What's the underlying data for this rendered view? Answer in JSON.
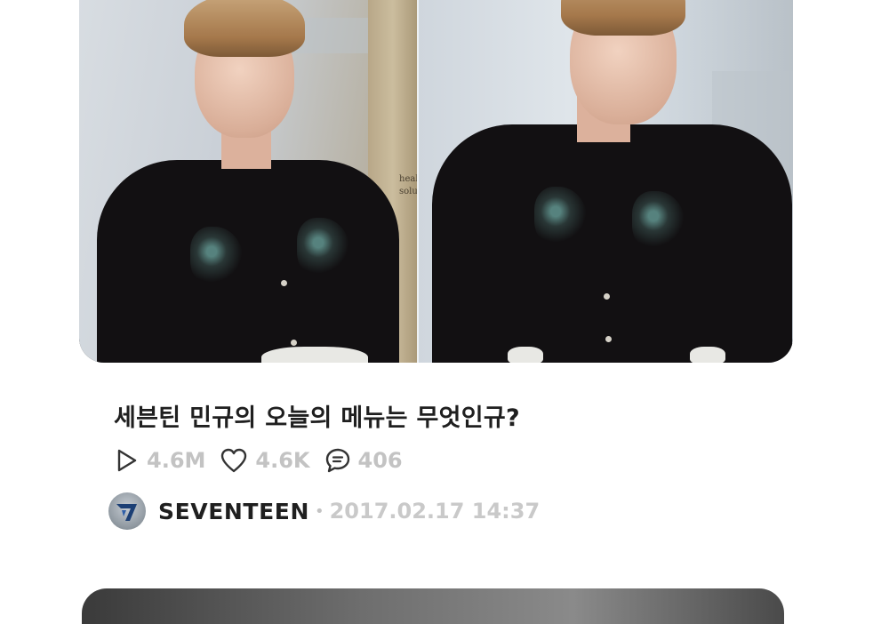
{
  "post": {
    "title": "세븐틴 민규의 오늘의 메뉴는 무엇인규?",
    "stats": {
      "plays": "4.6M",
      "likes": "4.6K",
      "comments": "406"
    },
    "channel": {
      "name": "SEVENTEEN",
      "separator": "•",
      "date": "2017.02.17 14:37"
    },
    "thumbnail": {
      "sign_text_line1": "heal",
      "sign_text_line2": "soluti"
    }
  },
  "icons": {
    "play": "play-icon",
    "like": "heart-icon",
    "comment": "comment-icon",
    "channel_logo": "seventeen-logo"
  },
  "colors": {
    "title": "#1f1f1f",
    "stat_text": "#c3c3c3",
    "date_text": "#c9c9c9",
    "icon_stroke": "#333333"
  }
}
